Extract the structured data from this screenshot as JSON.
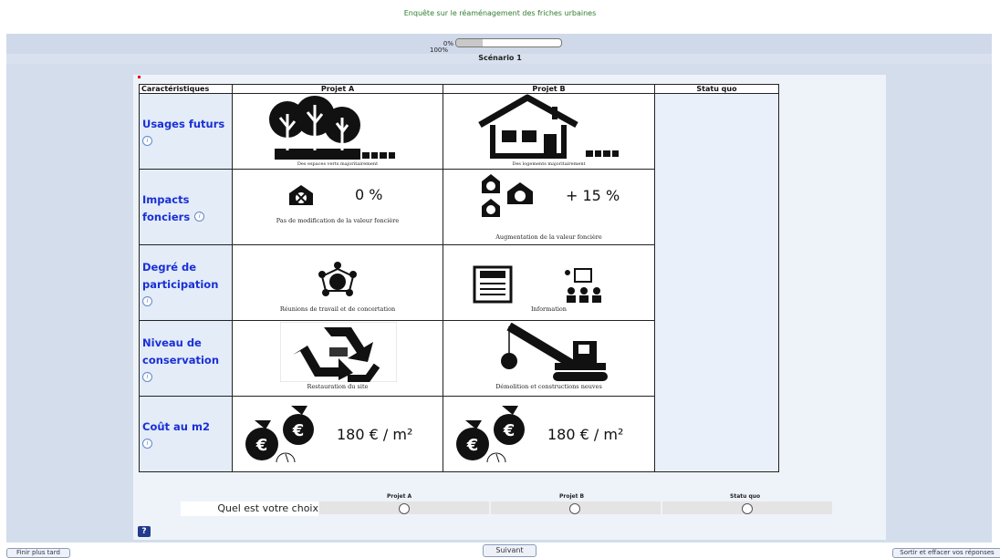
{
  "survey_title": "Enquête sur le réaménagement des friches urbaines",
  "progress": {
    "left_label": "0%",
    "right_label": "100%",
    "fraction": 0.25
  },
  "scenario_title": "Scénario 1",
  "table": {
    "headers": [
      "Caractéristiques",
      "Projet A",
      "Projet B",
      "Statu quo"
    ],
    "rows": [
      {
        "label": "Usages futurs",
        "a_caption": "Des espaces verts majoritairement",
        "b_caption": "Des logements majoritairement",
        "a_icon": "trees-icon",
        "b_icon": "house-icon"
      },
      {
        "label": "Impacts fonciers",
        "a_caption": "Pas de modification de la valeur foncière",
        "b_caption": "Augmentation de la valeur foncière",
        "a_value": "0 %",
        "b_value": "+ 15 %",
        "a_icon": "house-euro-crossed-icon",
        "b_icon": "houses-euro-icon"
      },
      {
        "label": "Degré de participation",
        "a_caption": "Réunions de travail et de concertation",
        "b_caption": "Information",
        "a_icon": "meeting-circle-icon",
        "b_icon": "news-presentation-icon"
      },
      {
        "label": "Niveau de conservation",
        "a_caption": "Restauration du site",
        "b_caption": "Démolition et constructions neuves",
        "a_icon": "recycle-icon",
        "b_icon": "wrecking-crane-icon"
      },
      {
        "label": "Coût au m2",
        "a_value": "180 € / m²",
        "b_value": "180 € / m²",
        "a_icon": "money-bags-euro-icon",
        "b_icon": "money-bags-euro-icon"
      }
    ]
  },
  "choice": {
    "question": "Quel est votre choix",
    "options": [
      "Projet A",
      "Projet B",
      "Statu quo"
    ]
  },
  "help_label": "?",
  "buttons": {
    "later": "Finir plus tard",
    "next": "Suivant",
    "exit": "Sortir et effacer vos réponses"
  }
}
